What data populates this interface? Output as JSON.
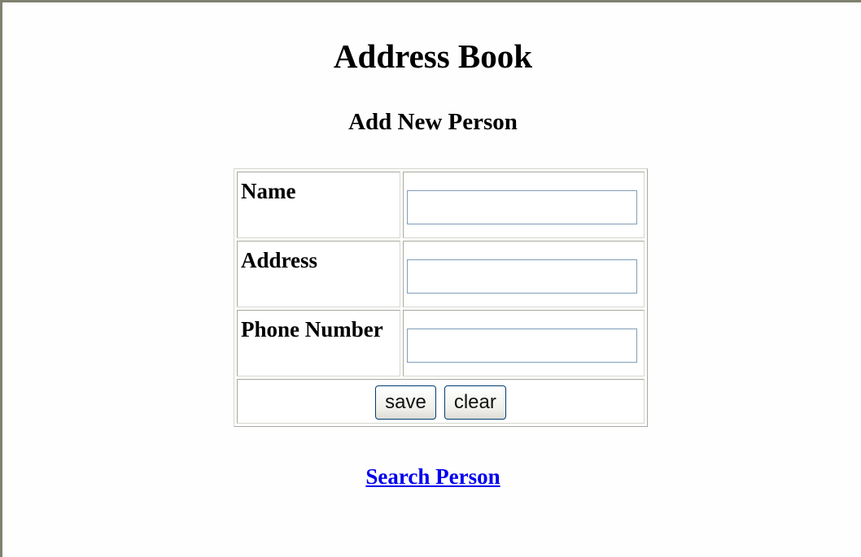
{
  "page": {
    "title": "Address Book",
    "heading": "Add New Person"
  },
  "form": {
    "fields": [
      {
        "label": "Name",
        "value": ""
      },
      {
        "label": "Address",
        "value": ""
      },
      {
        "label": "Phone Number",
        "value": ""
      }
    ],
    "save_label": "save",
    "clear_label": "clear"
  },
  "links": {
    "search_person": "Search Person"
  },
  "colors": {
    "link": "#0000ee",
    "input_border": "#7f9db9",
    "button_border": "#003c74"
  }
}
